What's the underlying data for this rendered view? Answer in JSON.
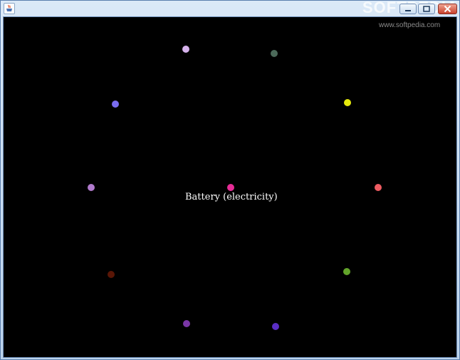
{
  "window": {
    "title_watermark": "SOFTPEDIA",
    "site_watermark": "www.softpedia.com"
  },
  "center_label": "Battery (electricity)",
  "node_colors": [
    "#d6b2ec",
    "#4c6a5a",
    "#7a6cf0",
    "#e6ea0c",
    "#b07acc",
    "#e62c96",
    "#ee5c62",
    "#5a1606",
    "#62a42a",
    "#7a36a6",
    "#5a2ec4"
  ]
}
